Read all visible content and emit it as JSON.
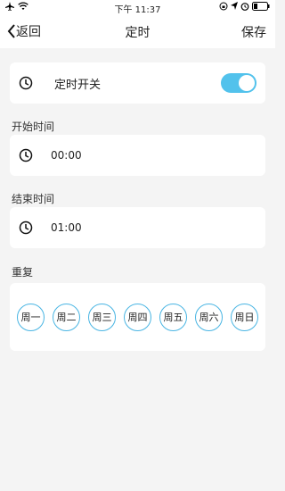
{
  "status": {
    "time": "下午 11:37"
  },
  "nav": {
    "back_label": "返回",
    "title": "定时",
    "save_label": "保存"
  },
  "switch": {
    "label": "定时开关",
    "on": true
  },
  "start": {
    "section": "开始时间",
    "value": "00:00"
  },
  "end": {
    "section": "结束时间",
    "value": "01:00"
  },
  "repeat": {
    "section": "重复",
    "days": [
      "周一",
      "周二",
      "周三",
      "周四",
      "周五",
      "周六",
      "周日"
    ]
  },
  "colors": {
    "accent": "#52c2ec",
    "day_border": "#49b5e3"
  }
}
